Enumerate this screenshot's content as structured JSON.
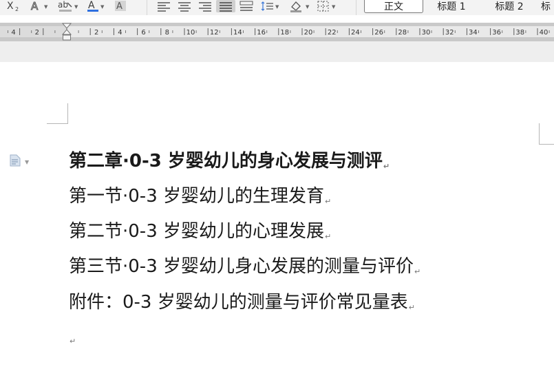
{
  "ribbon": {
    "styles": [
      {
        "label": "正文",
        "current": true
      },
      {
        "label": "标题 1",
        "current": false
      },
      {
        "label": "标题 2",
        "current": false
      },
      {
        "label": "标",
        "current": false
      }
    ]
  },
  "ruler": {
    "left_numbers": [
      "4",
      "2"
    ],
    "numbers": [
      "2",
      "4",
      "6",
      "8",
      "10",
      "12",
      "14",
      "16",
      "18",
      "20",
      "22",
      "24",
      "26",
      "28",
      "30",
      "32",
      "34",
      "36",
      "38",
      "40"
    ]
  },
  "document": {
    "lines": [
      {
        "text": "第二章·0-3 岁婴幼儿的身心发展与测评",
        "bold": true,
        "mark": "↵"
      },
      {
        "text": "第一节·0-3 岁婴幼儿的生理发育",
        "bold": false,
        "mark": "↵"
      },
      {
        "text": "第二节·0-3 岁婴幼儿的心理发展",
        "bold": false,
        "mark": "↵"
      },
      {
        "text": "第三节·0-3 岁婴幼儿身心发展的测量与评价",
        "bold": false,
        "mark": "↵"
      },
      {
        "text": "附件：0-3 岁婴幼儿的测量与评价常见量表",
        "bold": false,
        "mark": "↵"
      }
    ],
    "empty_mark": "↵"
  },
  "icons": {
    "toolbar": [
      "subscript-icon",
      "text-effect-icon",
      "highlight-icon",
      "font-color-icon",
      "char-shading-icon",
      "align-left-icon",
      "align-center-icon",
      "align-right-icon",
      "justify-icon",
      "distributed-icon",
      "line-spacing-icon",
      "shading-icon",
      "border-icon"
    ],
    "margin": "document-style-icon"
  }
}
